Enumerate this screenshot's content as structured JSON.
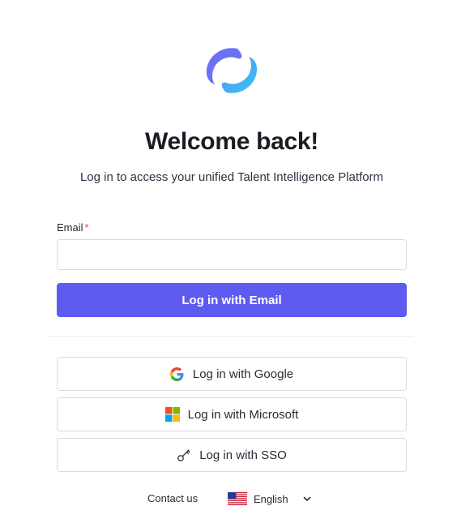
{
  "header": {
    "logo_icon": "brand-logo-icon",
    "title": "Welcome back!",
    "subtitle": "Log in to access your unified Talent Intelligence Platform"
  },
  "form": {
    "email_label": "Email",
    "required_marker": "*",
    "email_value": "",
    "email_placeholder": "",
    "submit_label": "Log in with Email"
  },
  "providers": {
    "google": {
      "label": "Log in with Google",
      "icon": "google-icon"
    },
    "microsoft": {
      "label": "Log in with Microsoft",
      "icon": "microsoft-icon"
    },
    "sso": {
      "label": "Log in with SSO",
      "icon": "key-icon"
    }
  },
  "footer": {
    "contact_label": "Contact us",
    "language": "English",
    "language_icon": "us-flag-icon"
  },
  "colors": {
    "accent": "#5d5bf0",
    "required": "#e5484d",
    "border": "#d9dbe1"
  }
}
